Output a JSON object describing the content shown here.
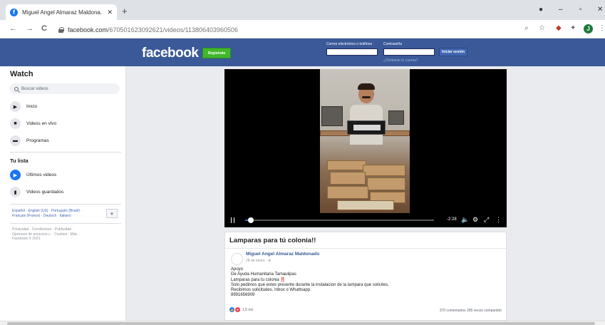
{
  "browser": {
    "tab_title": "Miguel Angel Almaraz Maldona...",
    "tab_close": "✕",
    "new_tab": "+",
    "url_host": "facebook.com",
    "url_path": "/670501623092621/videos/113806403960506",
    "back_icon": "←",
    "forward_icon": "→",
    "reload_icon": "C",
    "profile_initial": "J",
    "window_controls": [
      "–",
      "▫",
      "✕"
    ]
  },
  "header": {
    "logo": "facebook",
    "register_label": "Regístrate",
    "email_label": "Correo electrónico o teléfono",
    "password_label": "Contraseña",
    "login_label": "Iniciar sesión",
    "forgot_label": "¿Olvidaste tu cuenta?"
  },
  "sidebar": {
    "title": "Watch",
    "search_placeholder": "Buscar videos",
    "items": [
      {
        "label": "Inicio"
      },
      {
        "label": "Videos en vivo"
      },
      {
        "label": "Programas"
      }
    ],
    "list_title": "Tu lista",
    "list_items": [
      {
        "label": "Últimos videos"
      },
      {
        "label": "Videos guardados"
      }
    ],
    "languages_line1": "Español · English (US) · Português (Brasil) ·",
    "languages_line2": "Français (France) · Deutsch · Italiano",
    "plus": "+",
    "footer_line1": "Privacidad · Condiciones · Publicidad ·",
    "footer_line2": "Opciones de anuncios ▷ · Cookies · Más ·",
    "footer_line3": "Facebook © 2021"
  },
  "video": {
    "time_remaining": "-2:28",
    "progress": 0.03
  },
  "post": {
    "title": "Lamparas para tú colonia!!",
    "author": "Miguel Angel Almaraz Maldonado",
    "date": "28 de enero · ⊕",
    "body": [
      "Apoyo",
      "De Ayuda Humanitaria Tamaulipas",
      "Lamparas para tu colonia ‼️",
      "Solo pedimos que estes presente durante la instalacion de la lampara que solicites.",
      "Recibimos solicitudes. Inbox o Whattsapp",
      "8991656909"
    ],
    "reactions_count": "1,5 mil",
    "comments_shares": "370 comentarios  285 veces compartido",
    "colors": {
      "like": "#1877f2",
      "love": "#f33e58"
    }
  }
}
